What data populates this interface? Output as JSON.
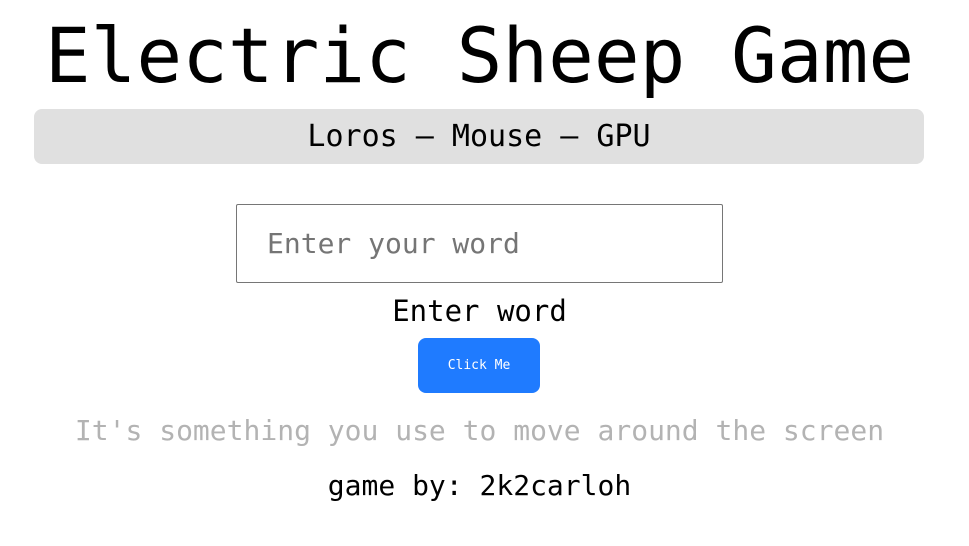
{
  "header": {
    "title": "Electric Sheep Game"
  },
  "word_bar": {
    "text": "Loros – Mouse – GPU"
  },
  "word_input": {
    "placeholder": "Enter your word",
    "value": ""
  },
  "input_label": "Enter word",
  "button": {
    "label": "Click Me"
  },
  "hint": "It's something you use to move around the screen",
  "credit": "game by: 2k2carloh",
  "colors": {
    "accent": "#1f7bff",
    "bar_background": "#e0e0e0",
    "hint_text": "#b3b3b3"
  }
}
